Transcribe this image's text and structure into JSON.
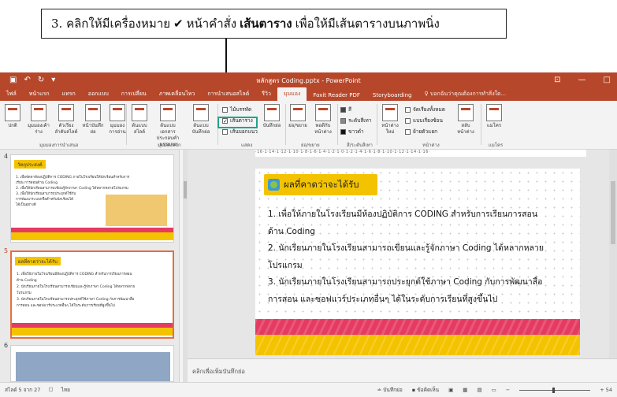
{
  "callout": {
    "prefix": "3. คลิกให้มีเครื่องหมาย",
    "check": "✔",
    "middle": "หน้าคำสั่ง",
    "bold": "เส้นตาราง",
    "suffix": "เพื่อให้มีเส้นตารางบนภาพนิ่ง"
  },
  "window": {
    "title": "หลักสูตร Coding.pptx - PowerPoint",
    "tabs": [
      "ไฟล์",
      "หน้าแรก",
      "แทรก",
      "ออกแบบ",
      "การเปลี่ยน",
      "ภาพเคลื่อนไหว",
      "การนำเสนอสไลด์",
      "รีวิว",
      "มุมมอง",
      "Foxit Reader PDF",
      "Storyboarding"
    ],
    "active_tab_index": 8,
    "search_text": "บอกฉันว่าคุณต้องการทำสิ่งใด...",
    "accent": "#b7472a"
  },
  "ribbon": {
    "buttons": [
      {
        "label": "ปกติ"
      },
      {
        "label": "มุมมองเค้าร่าง"
      },
      {
        "label": "ตัวเรียงลำดับสไลด์"
      },
      {
        "label": "หน้าบันทึกย่อ"
      },
      {
        "label": "มุมมองการอ่าน"
      },
      {
        "label": "ต้นแบบสไลด์"
      },
      {
        "label": "ต้นแบบเอกสารประกอบคำบรรยาย"
      },
      {
        "label": "ต้นแบบบันทึกย่อ"
      },
      {
        "label": "บันทึกย่อ"
      },
      {
        "label": "ย่อ/ขยาย"
      },
      {
        "label": "พอดีกับหน้าต่าง"
      },
      {
        "label": "หน้าต่างใหม่"
      },
      {
        "label": "สลับหน้าต่าง"
      },
      {
        "label": "แมโคร"
      }
    ],
    "show_items": [
      {
        "label": "ไม้บรรทัด",
        "checked": false
      },
      {
        "label": "เส้นตาราง",
        "checked": true
      },
      {
        "label": "เส้นบอกแนว",
        "checked": false
      }
    ],
    "color_items": [
      "สี",
      "ระดับสีเทา",
      "ขาวดำ"
    ],
    "window_items": [
      "จัดเรียงทั้งหมด",
      "แบบเรียงซ้อน",
      "ย้ายตัวแยก"
    ],
    "groups": [
      "มุมมองการนำเสนอ",
      "มุมมองหลัก",
      "แสดง",
      "ย่อ/ขยาย",
      "สี/ระดับสีเทา",
      "หน้าต่าง",
      "แมโคร"
    ]
  },
  "thumbnails": [
    {
      "number": "4",
      "heading": "วัตถุประสงค์",
      "lines": [
        "1. เพื่อจัดหาห้องปฏิบัติการ CODING ภายในโรงเรียนให้นักเรียนสำหรับการ",
        "เรียน การสอนด้าน Coding",
        "2. เพื่อให้นักเรียนสามารถเขียนรู้จักภาษา Coding ได้หลากหลายโปรแกรม",
        "3. เพื่อให้นักเรียนสามารถประยุกต์ใช้กับ",
        "การพัฒนาระบบหรือสำหรับนักเรียนได้",
        "ได้เป็นอย่างดี"
      ],
      "selected": false
    },
    {
      "number": "5",
      "heading": "ผลที่คาดว่าจะได้รับ",
      "lines": [
        "1. เพื่อให้ภายในโรงเรียนมีห้องปฏิบัติการ CODING สำหรับการเรียนการสอน",
        "ด้าน Coding",
        "2. นักเรียนภายในโรงเรียนสามารถเขียนและรู้จักภาษา Coding ได้หลากหลาย",
        "โปรแกรม",
        "3. นักเรียนภายในโรงเรียนสามารถประยุกต์ใช้ภาษา Coding กับการพัฒนาสื่อ",
        "การสอน และซอฟแวร์ประเภทอื่นๆ ได้ในระดับการเรียนที่สูงขึ้นไป"
      ],
      "selected": true
    },
    {
      "number": "6",
      "heading": "",
      "lines": [],
      "selected": false
    }
  ],
  "ruler_text": "·16·1·14·1·12·1·10·1·8·1·6·1·4·1·2·1·0·1·2·1·4·1·6·1·8·1·10·1·12·1·14·1·16·",
  "slide": {
    "heading": "ผลที่คาดว่าจะได้รับ",
    "lines": [
      "1. เพื่อให้ภายในโรงเรียนมีห้องปฏิบัติการ CODING  สำหรับการเรียนการสอน",
      "ด้าน Coding",
      "2. นักเรียนภายในโรงเรียนสามารถเขียนและรู้จักภาษา Coding ได้หลากหลาย",
      "โปรแกรม",
      "3. นักเรียนภายในโรงเรียนสามารถประยุกต์ใช้ภาษา Coding กับการพัฒนาสื่อ",
      "การสอน และซอฟแวร์ประเภทอื่นๆ ได้ในระดับการเรียนที่สูงขึ้นไป"
    ]
  },
  "notes_placeholder": "คลิกเพื่อเพิ่มบันทึกย่อ",
  "status": {
    "slide_info": "สไลด์ 5 จาก 27",
    "language": "ไทย",
    "notes_btn": "บันทึกย่อ",
    "comments_btn": "ข้อคิดเห็น",
    "zoom": "+ 54"
  }
}
